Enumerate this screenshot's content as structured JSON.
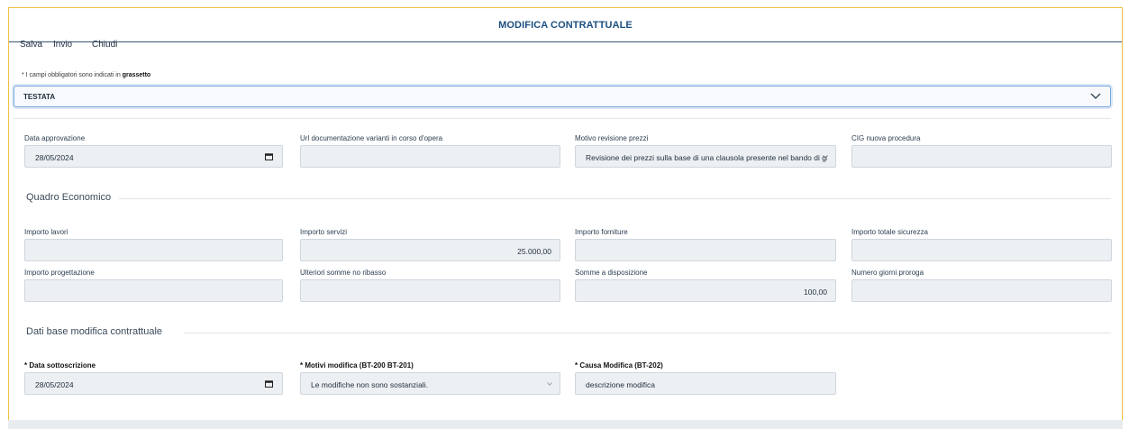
{
  "window": {
    "title": "MODIFICA CONTRATTUALE"
  },
  "toolbar": {
    "salva": "Salva",
    "invio": "Invio",
    "chiudi": "Chiudi"
  },
  "note": {
    "prefix": "* I campi obbligatori sono indicati in",
    "bold": "grassetto"
  },
  "accordion": {
    "label": "TESTATA",
    "icon": "chevron-down-icon"
  },
  "row1": {
    "data_approvazione": {
      "label": "Data approvazione",
      "value": "28/05/2024"
    },
    "url_doc": {
      "label": "Url documentazione varianti in corso d'opera",
      "value": ""
    },
    "motivo_revisione": {
      "label": "Motivo revisione prezzi",
      "value": "Revisione dei prezzi sulla base di una clausola presente nel bando di gara"
    },
    "cig": {
      "label": "CIG nuova procedura",
      "value": ""
    }
  },
  "quadro": {
    "title": "Quadro Economico",
    "importo_lavori": {
      "label": "Importo lavori",
      "value": ""
    },
    "importo_servizi": {
      "label": "Importo servizi",
      "value": "25.000,00"
    },
    "importo_forniture": {
      "label": "Importo forniture",
      "value": ""
    },
    "importo_sicurezza": {
      "label": "Importo totale sicurezza",
      "value": ""
    },
    "importo_progettazione": {
      "label": "Importo progettazione",
      "value": ""
    },
    "ulteriori_somme": {
      "label": "Ulteriori somme no ribasso",
      "value": ""
    },
    "somme_disposizione": {
      "label": "Somme a disposizione",
      "value": "100,00"
    },
    "giorni_proroga": {
      "label": "Numero giorni proroga",
      "value": ""
    }
  },
  "dati_base": {
    "title": "Dati base modifica contrattuale",
    "data_sottoscrizione": {
      "label": "* Data sottoscrizione",
      "value": "28/05/2024"
    },
    "motivi_modifica": {
      "label": "* Motivi modifica (BT-200 BT-201)",
      "value": "Le modifiche non sono sostanziali."
    },
    "causa_modifica": {
      "label": "* Causa Modifica (BT-202)",
      "value": "descrizione modifica"
    }
  },
  "colors": {
    "title": "#1d4f80",
    "frame": "#f0c040",
    "field_bg": "#edf0f3",
    "accordion_border": "#7ba9e0"
  }
}
